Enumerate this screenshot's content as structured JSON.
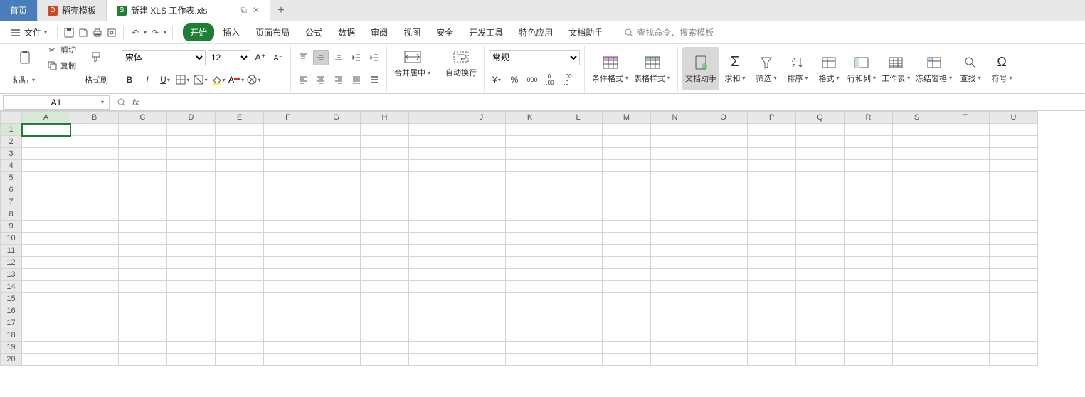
{
  "tabs": {
    "home": "首页",
    "template": "稻壳模板",
    "doc": "新建 XLS 工作表.xls"
  },
  "file_menu": "文件",
  "menu_tabs": [
    "开始",
    "插入",
    "页面布局",
    "公式",
    "数据",
    "审阅",
    "视图",
    "安全",
    "开发工具",
    "特色应用",
    "文档助手"
  ],
  "active_menu_tab": 0,
  "search_placeholder": "查找命令、搜索模板",
  "clipboard": {
    "paste": "粘贴",
    "cut": "剪切",
    "copy": "复制",
    "format_painter": "格式刷"
  },
  "font": {
    "name": "宋体",
    "size": "12"
  },
  "align": {
    "merge_center": "合并居中",
    "wrap": "自动换行"
  },
  "number": {
    "format": "常规"
  },
  "styles": {
    "cond": "条件格式",
    "table": "表格样式"
  },
  "tools": {
    "doc_helper": "文档助手",
    "sum": "求和",
    "filter": "筛选",
    "sort": "排序",
    "format": "格式",
    "rowcol": "行和列",
    "sheet": "工作表",
    "freeze": "冻结窗格",
    "find": "查找",
    "symbol": "符号"
  },
  "namebox": "A1",
  "columns": [
    "A",
    "B",
    "C",
    "D",
    "E",
    "F",
    "G",
    "H",
    "I",
    "J",
    "K",
    "L",
    "M",
    "N",
    "O",
    "P",
    "Q",
    "R",
    "S",
    "T",
    "U"
  ],
  "rows": 20,
  "selected_cell": {
    "col": 0,
    "row": 0
  }
}
